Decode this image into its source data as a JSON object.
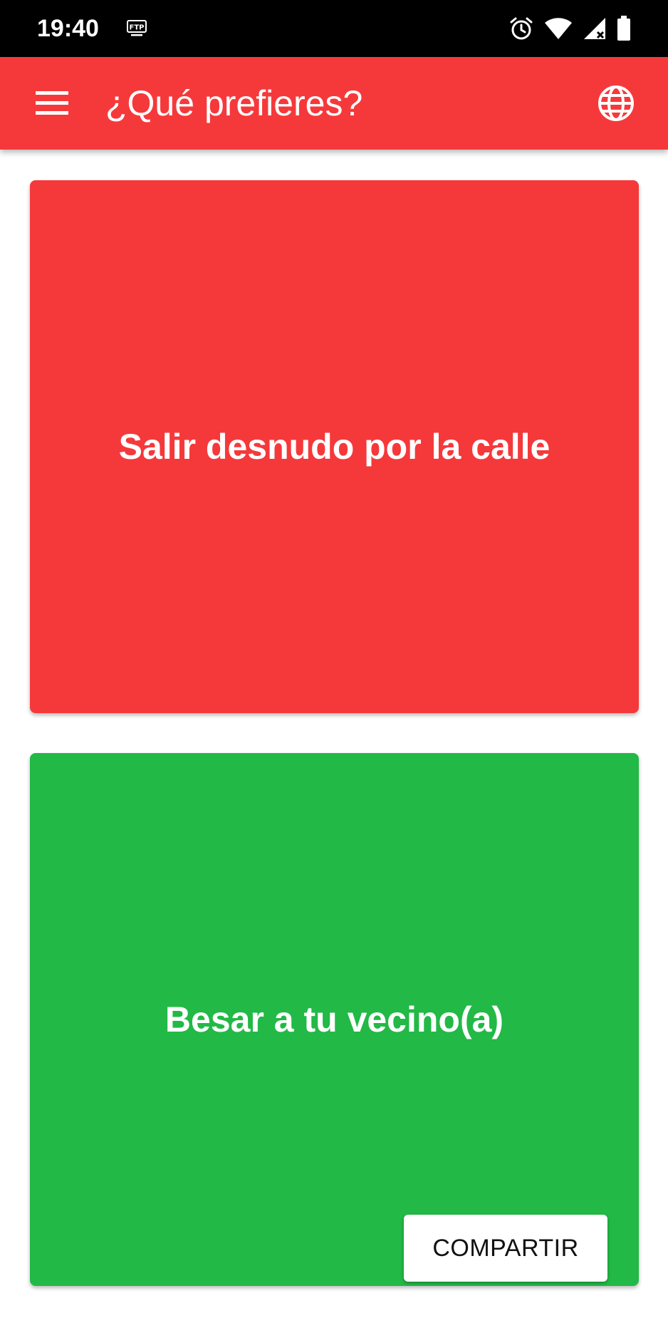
{
  "status_bar": {
    "time": "19:40",
    "icons": [
      "ftp-icon",
      "alarm-icon",
      "wifi-icon",
      "cellular-signal-icon",
      "battery-icon"
    ]
  },
  "app_bar": {
    "title": "¿Qué prefieres?",
    "menu_icon": "menu-icon",
    "language_icon": "globe-icon",
    "color": "#f5393b"
  },
  "options": [
    {
      "text": "Salir desnudo por la calle",
      "color": "#f5393b"
    },
    {
      "text": "Besar a tu vecino(a)",
      "color": "#22b946"
    }
  ],
  "share": {
    "label": "COMPARTIR"
  }
}
